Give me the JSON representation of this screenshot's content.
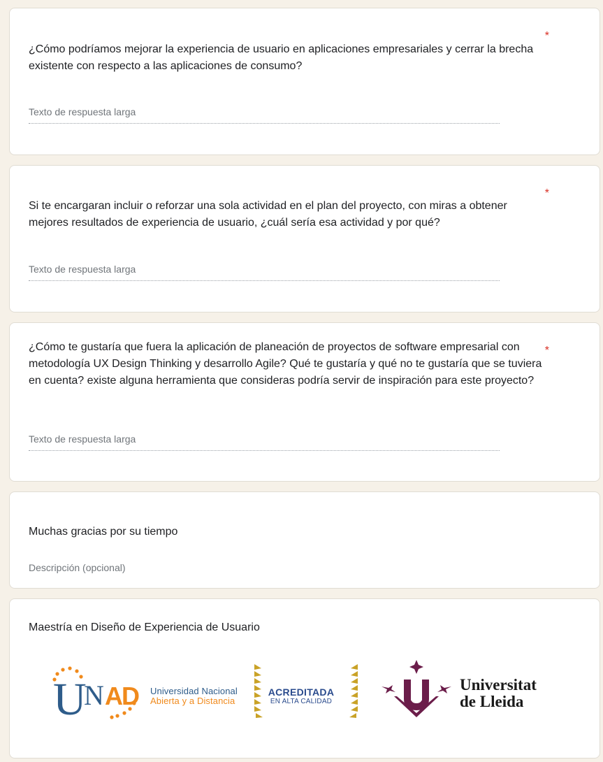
{
  "questions": [
    {
      "text": "¿Cómo podríamos mejorar la experiencia de usuario en aplicaciones empresariales y cerrar la brecha existente con respecto a las aplicaciones de consumo?",
      "required_mark": "*",
      "answer_placeholder": "Texto de respuesta larga"
    },
    {
      "text": "Si te encargaran incluir o reforzar una sola actividad en el plan del proyecto, con miras a obtener mejores resultados de experiencia de usuario, ¿cuál sería esa actividad y por qué?",
      "required_mark": "*",
      "answer_placeholder": "Texto de respuesta larga"
    },
    {
      "text": "¿Cómo te gustaría que fuera la aplicación de planeación de proyectos de software empresarial con metodología UX Design Thinking y desarrollo Agile? Qué te gustaría y qué no te gustaría que se tuviera en cuenta?  existe alguna herramienta que consideras podría servir de inspiración para este proyecto?",
      "required_mark": "*",
      "answer_placeholder": "Texto de respuesta larga"
    }
  ],
  "thanks_section": {
    "title": "Muchas gracias por su tiempo",
    "description": "Descripción (opcional)"
  },
  "footer_section": {
    "title": "Maestría en Diseño de Experiencia de Usuario",
    "logos": {
      "unad_wordmark": "UNAD",
      "unad_line1": "Universidad Nacional",
      "unad_line2": "Abierta y a Distancia",
      "acreditada_line1": "ACREDITADA",
      "acreditada_line2": "EN ALTA CALIDAD",
      "udl_line1": "Universitat",
      "udl_line2": "de Lleida"
    }
  },
  "colors": {
    "page_background": "#f6f1e8",
    "required_star": "#d93025",
    "unad_blue": "#2e5c8a",
    "unad_orange": "#f08a1c",
    "acreditada_gold": "#c9a227",
    "udl_purple": "#6b1d4a"
  }
}
